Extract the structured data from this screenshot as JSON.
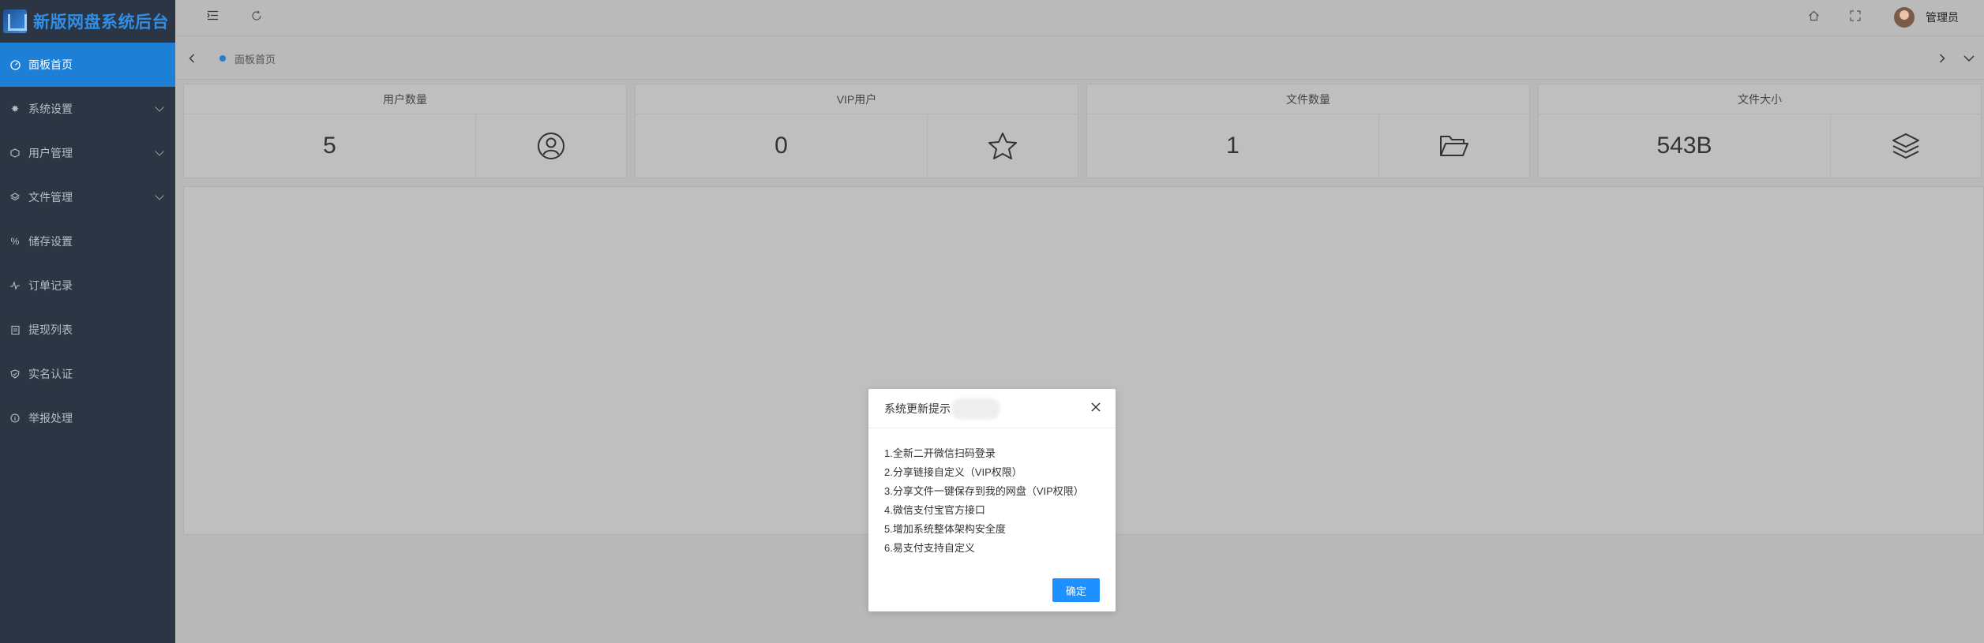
{
  "app": {
    "logo_text": "新版网盘系统后台"
  },
  "sidebar": {
    "items": [
      {
        "label": "面板首页",
        "icon": "gauge-icon",
        "active": true,
        "expandable": false
      },
      {
        "label": "系统设置",
        "icon": "gear-icon",
        "active": false,
        "expandable": true
      },
      {
        "label": "用户管理",
        "icon": "cube-icon",
        "active": false,
        "expandable": true
      },
      {
        "label": "文件管理",
        "icon": "layers-icon",
        "active": false,
        "expandable": true
      },
      {
        "label": "储存设置",
        "icon": "percent-icon",
        "active": false,
        "expandable": false
      },
      {
        "label": "订单记录",
        "icon": "pulse-icon",
        "active": false,
        "expandable": false
      },
      {
        "label": "提现列表",
        "icon": "clipboard-icon",
        "active": false,
        "expandable": false
      },
      {
        "label": "实名认证",
        "icon": "shield-check-icon",
        "active": false,
        "expandable": false
      },
      {
        "label": "举报处理",
        "icon": "info-circle-icon",
        "active": false,
        "expandable": false
      }
    ]
  },
  "header": {
    "user_name": "管理员"
  },
  "tabs": [
    {
      "label": "面板首页",
      "active": true
    }
  ],
  "stats": [
    {
      "title": "用户数量",
      "value": "5",
      "icon": "user-circle-icon"
    },
    {
      "title": "VIP用户",
      "value": "0",
      "icon": "star-icon"
    },
    {
      "title": "文件数量",
      "value": "1",
      "icon": "folder-open-icon"
    },
    {
      "title": "文件大小",
      "value": "543B",
      "icon": "layers-icon"
    }
  ],
  "modal": {
    "title": "系统更新提示",
    "lines": [
      "1.全新二开微信扫码登录",
      "2.分享链接自定义（VIP权限）",
      "3.分享文件一键保存到我的网盘（VIP权限）",
      "4.微信支付宝官方接口",
      "5.增加系统整体架构安全度",
      "6.易支付支持自定义"
    ],
    "confirm_label": "确定"
  },
  "colors": {
    "accent": "#1e7fd6",
    "sidebar_bg": "#2b3543",
    "logo_text": "#2f8fe8",
    "button": "#1e90ff"
  }
}
